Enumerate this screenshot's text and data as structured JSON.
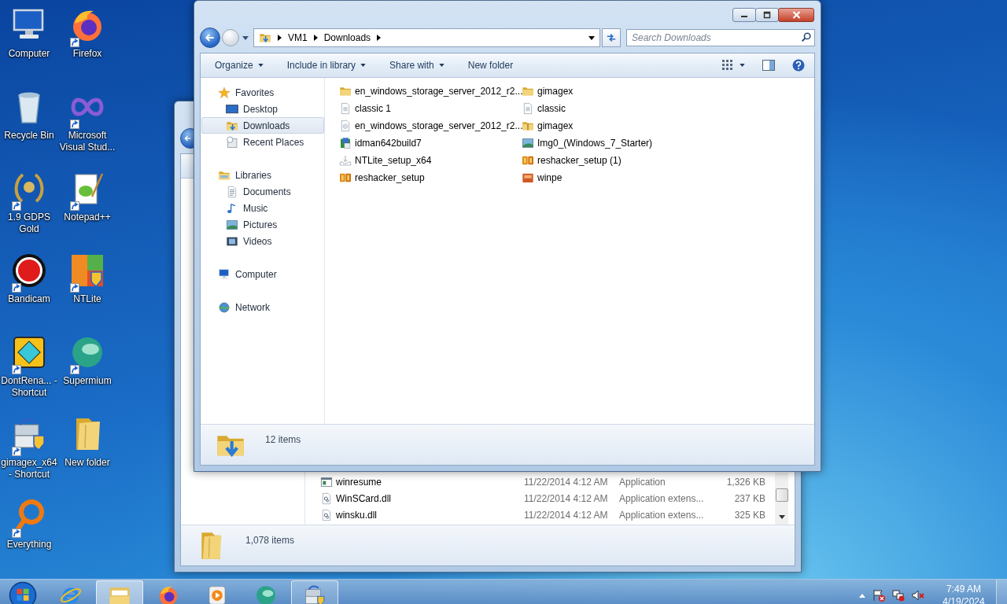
{
  "desktop_icons": [
    {
      "label": "Computer",
      "kind": "computer",
      "shortcut": false
    },
    {
      "label": "Firefox",
      "kind": "firefox",
      "shortcut": true
    },
    {
      "label": "Recycle Bin",
      "kind": "recycle-bin",
      "shortcut": false
    },
    {
      "label": "Microsoft Visual Stud...",
      "kind": "visual-studio",
      "shortcut": true
    },
    {
      "label": "1.9 GDPS Gold",
      "kind": "wreath",
      "shortcut": true
    },
    {
      "label": "Notepad++",
      "kind": "notepad",
      "shortcut": true
    },
    {
      "label": "Bandicam",
      "kind": "record",
      "shortcut": true
    },
    {
      "label": "NTLite",
      "kind": "ntlite",
      "shortcut": true
    },
    {
      "label": "DontRena... - Shortcut",
      "kind": "game",
      "shortcut": true
    },
    {
      "label": "Supermium",
      "kind": "supermium",
      "shortcut": true
    },
    {
      "label": "gimagex_x64 - Shortcut",
      "kind": "installer",
      "shortcut": true
    },
    {
      "label": "New folder",
      "kind": "folder-tall",
      "shortcut": false
    },
    {
      "label": "Everything",
      "kind": "ring",
      "shortcut": true
    }
  ],
  "back_window": {
    "rows": [
      {
        "name": "winresume",
        "date": "11/22/2014 4:12 AM",
        "type": "Application",
        "size": "1,326 KB",
        "kind": "app"
      },
      {
        "name": "WinSCard.dll",
        "date": "11/22/2014 4:12 AM",
        "type": "Application extens...",
        "size": "237 KB",
        "kind": "dll"
      },
      {
        "name": "winsku.dll",
        "date": "11/22/2014 4:12 AM",
        "type": "Application extens...",
        "size": "325 KB",
        "kind": "dll"
      }
    ],
    "status": "1,078 items"
  },
  "front_window": {
    "address": [
      "VM1",
      "Downloads"
    ],
    "search": {
      "placeholder": "Search Downloads"
    },
    "toolbar": [
      {
        "label": "Organize",
        "dropdown": true
      },
      {
        "label": "Include in library",
        "dropdown": true
      },
      {
        "label": "Share with",
        "dropdown": true
      },
      {
        "label": "New folder",
        "dropdown": false
      }
    ],
    "nav": [
      {
        "label": "Favorites",
        "kind": "star",
        "selected": false,
        "children": [
          {
            "label": "Desktop",
            "kind": "desktop",
            "selected": false
          },
          {
            "label": "Downloads",
            "kind": "downloads",
            "selected": true
          },
          {
            "label": "Recent Places",
            "kind": "recent",
            "selected": false
          }
        ]
      },
      {
        "label": "Libraries",
        "kind": "library",
        "selected": false,
        "children": [
          {
            "label": "Documents",
            "kind": "doc",
            "selected": false
          },
          {
            "label": "Music",
            "kind": "music",
            "selected": false
          },
          {
            "label": "Pictures",
            "kind": "picture",
            "selected": false
          },
          {
            "label": "Videos",
            "kind": "video",
            "selected": false
          }
        ]
      },
      {
        "label": "Computer",
        "kind": "computer",
        "selected": false
      },
      {
        "label": "Network",
        "kind": "network",
        "selected": false
      }
    ],
    "files": [
      {
        "name": "en_windows_storage_server_2012_r2...",
        "kind": "folder"
      },
      {
        "name": "classic 1",
        "kind": "image"
      },
      {
        "name": "en_windows_storage_server_2012_r2...",
        "kind": "disc"
      },
      {
        "name": "idman642build7",
        "kind": "setup"
      },
      {
        "name": "NTLite_setup_x64",
        "kind": "tray"
      },
      {
        "name": "reshacker_setup",
        "kind": "rh"
      },
      {
        "name": "gimagex",
        "kind": "folder"
      },
      {
        "name": "classic",
        "kind": "image"
      },
      {
        "name": "gimagex",
        "kind": "zip"
      },
      {
        "name": "Img0_(Windows_7_Starter)",
        "kind": "picture"
      },
      {
        "name": "reshacker_setup (1)",
        "kind": "rh"
      },
      {
        "name": "winpe",
        "kind": "winpe"
      }
    ],
    "status": "12 items"
  },
  "taskbar": {
    "buttons": [
      {
        "kind": "ie",
        "running": false,
        "selected": false
      },
      {
        "kind": "explorer",
        "running": true,
        "selected": true
      },
      {
        "kind": "firefox",
        "running": false,
        "selected": false
      },
      {
        "kind": "media",
        "running": false,
        "selected": false
      },
      {
        "kind": "supermium",
        "running": false,
        "selected": false
      },
      {
        "kind": "installer",
        "running": true,
        "selected": false
      }
    ],
    "time": "7:49 AM",
    "date": "4/19/2024"
  }
}
